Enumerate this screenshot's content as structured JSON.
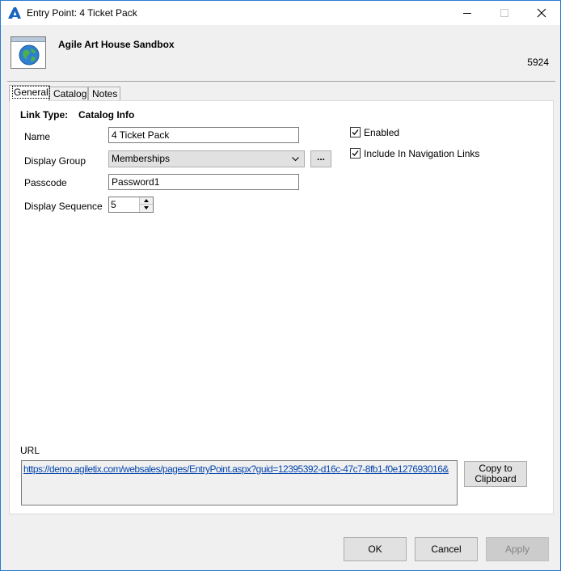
{
  "window": {
    "title": "Entry Point: 4 Ticket Pack",
    "icon": "agile-a-icon"
  },
  "header": {
    "org_name": "Agile Art House Sandbox",
    "record_id": "5924",
    "icon": "globe-icon"
  },
  "tabs": [
    {
      "label": "General",
      "active": true
    },
    {
      "label": "Catalog",
      "active": false
    },
    {
      "label": "Notes",
      "active": false
    }
  ],
  "general": {
    "link_type_label": "Link Type:",
    "link_type_value": "Catalog Info",
    "name_label": "Name",
    "name_value": "4 Ticket Pack",
    "display_group_label": "Display Group",
    "display_group_value": "Memberships",
    "ellipsis_label": "...",
    "passcode_label": "Passcode",
    "passcode_value": "Password1",
    "display_sequence_label": "Display Sequence",
    "display_sequence_value": "5",
    "enabled_label": "Enabled",
    "enabled_checked": true,
    "nav_links_label": "Include In Navigation Links",
    "nav_links_checked": true,
    "url_label": "URL",
    "url_value": "https://demo.agiletix.com/websales/pages/EntryPoint.aspx?guid=12395392-d16c-47c7-8fb1-f0e127693016&",
    "copy_label_line1": "Copy to",
    "copy_label_line2": "Clipboard"
  },
  "buttons": {
    "ok": "OK",
    "cancel": "Cancel",
    "apply": "Apply"
  },
  "colors": {
    "window_border": "#2b79d0",
    "link": "#0645ad",
    "app_icon_blue": "#1565c0"
  }
}
